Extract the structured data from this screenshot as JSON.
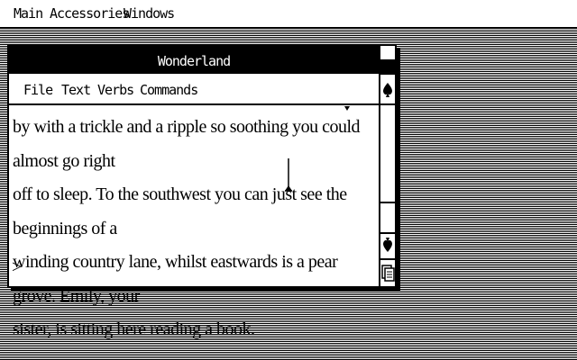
{
  "menubar": {
    "items": [
      "Main",
      "Accessories",
      "Windows"
    ]
  },
  "window": {
    "title": "Wonderland",
    "menu": [
      "File",
      "Text",
      "Verbs",
      "Commands"
    ],
    "text_lines": [
      "by with a trickle and a ripple so soothing you could almost go right",
      "off to sleep. To the southwest you can just see the beginnings of a",
      "winding country lane, whilst eastwards is a pear grove. Emily, your",
      "sister, is sitting here reading a book."
    ],
    "prompt": ">"
  },
  "icons": {
    "scroll_up": "spade-up-icon",
    "scroll_down": "spade-down-icon",
    "resize": "resize-icon"
  }
}
